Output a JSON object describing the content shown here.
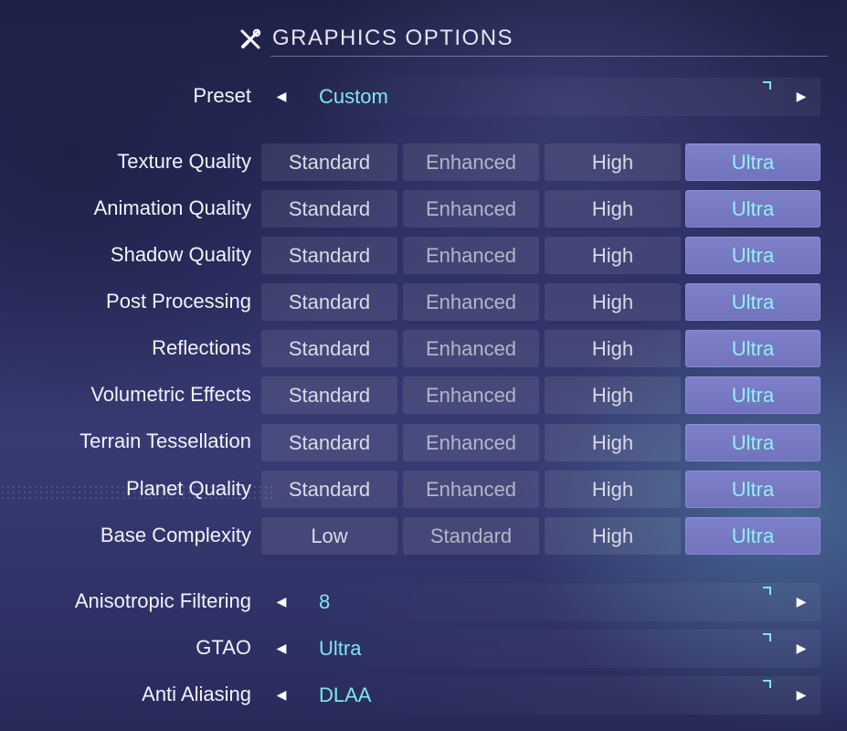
{
  "header": {
    "title": "GRAPHICS OPTIONS",
    "icon": "tools-icon"
  },
  "preset": {
    "label": "Preset",
    "value": "Custom"
  },
  "quality_rows": [
    {
      "label": "Texture Quality",
      "options": [
        "Standard",
        "Enhanced",
        "High",
        "Ultra"
      ],
      "selected": "Ultra"
    },
    {
      "label": "Animation Quality",
      "options": [
        "Standard",
        "Enhanced",
        "High",
        "Ultra"
      ],
      "selected": "Ultra"
    },
    {
      "label": "Shadow Quality",
      "options": [
        "Standard",
        "Enhanced",
        "High",
        "Ultra"
      ],
      "selected": "Ultra"
    },
    {
      "label": "Post Processing",
      "options": [
        "Standard",
        "Enhanced",
        "High",
        "Ultra"
      ],
      "selected": "Ultra"
    },
    {
      "label": "Reflections",
      "options": [
        "Standard",
        "Enhanced",
        "High",
        "Ultra"
      ],
      "selected": "Ultra"
    },
    {
      "label": "Volumetric Effects",
      "options": [
        "Standard",
        "Enhanced",
        "High",
        "Ultra"
      ],
      "selected": "Ultra"
    },
    {
      "label": "Terrain Tessellation",
      "options": [
        "Standard",
        "Enhanced",
        "High",
        "Ultra"
      ],
      "selected": "Ultra"
    },
    {
      "label": "Planet Quality",
      "options": [
        "Standard",
        "Enhanced",
        "High",
        "Ultra"
      ],
      "selected": "Ultra"
    },
    {
      "label": "Base Complexity",
      "options": [
        "Low",
        "Standard",
        "High",
        "Ultra"
      ],
      "selected": "Ultra"
    }
  ],
  "selectors": [
    {
      "label": "Anisotropic Filtering",
      "value": "8"
    },
    {
      "label": "GTAO",
      "value": "Ultra"
    },
    {
      "label": "Anti Aliasing",
      "value": "DLAA"
    }
  ],
  "colors": {
    "accent_cyan": "#7fe6ee",
    "selected_bg": "#7577c2",
    "background": "#2f3266"
  }
}
